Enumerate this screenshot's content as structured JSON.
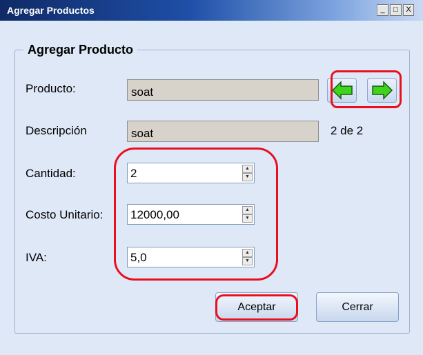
{
  "window": {
    "title": "Agregar Productos",
    "controls": {
      "minimize": "_",
      "maximize": "□",
      "close": "X"
    }
  },
  "group": {
    "legend": "Agregar Producto"
  },
  "fields": {
    "producto": {
      "label": "Producto:",
      "value": "soat"
    },
    "descripcion": {
      "label": "Descripción",
      "value": "soat"
    },
    "cantidad": {
      "label": "Cantidad:",
      "value": "2"
    },
    "costo": {
      "label": "Costo Unitario:",
      "value": "12000,00"
    },
    "iva": {
      "label": "IVA:",
      "value": "5,0"
    }
  },
  "navigation": {
    "counter": "2 de 2",
    "prev_icon": "arrow-left-icon",
    "next_icon": "arrow-right-icon",
    "arrow_color": "#3fd41c"
  },
  "buttons": {
    "aceptar": "Aceptar",
    "cerrar": "Cerrar"
  },
  "annotations": {
    "highlight_color": "#e8101f"
  }
}
